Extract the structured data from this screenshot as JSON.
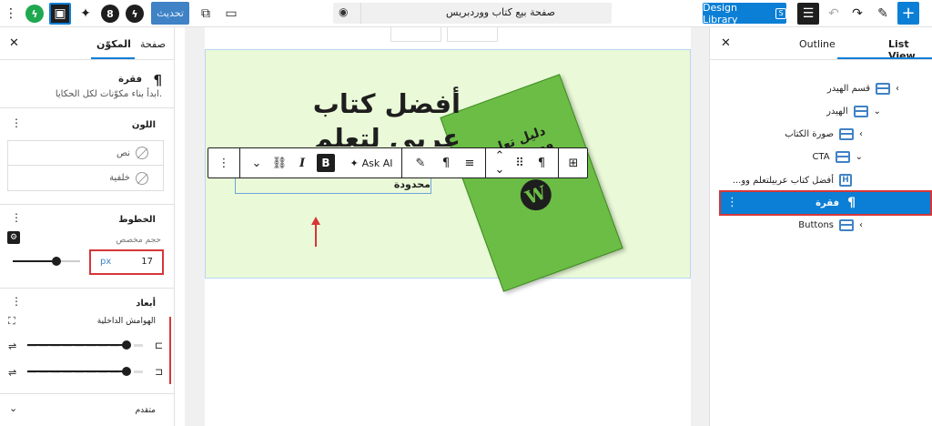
{
  "topbar": {
    "update_label": "تحديث",
    "document_title": "صفحة بيع كتاب ووردبريس",
    "design_library_label": "Design Library",
    "design_library_badge": "S",
    "icons": {
      "kebab": "⋮",
      "sidebar_toggle": "▣",
      "sparkle": "✦",
      "kadence": "8",
      "lightning": "ϟ",
      "green_bolt": "ϟ",
      "external": "⧉",
      "device": "▭",
      "eye": "◉",
      "list_view": "☰",
      "undo": "↶",
      "redo": "↷",
      "pen": "✎",
      "plus": "+"
    }
  },
  "left_panel": {
    "tab_block": "المكوّن",
    "tab_page": "صفحة",
    "close": "✕",
    "block_icon": "¶",
    "block_name": "فقرة",
    "block_description": "ابدأ بناء مكوّنات لكل الحكايا.",
    "color_section": {
      "title": "اللون",
      "dots": "⋮",
      "text_label": "نص",
      "background_label": "خلفية"
    },
    "typography_section": {
      "title": "الخطوط",
      "dots": "⋮",
      "size_label": "حجم مخصص",
      "size_value": "17",
      "size_unit": "px",
      "slider_fraction": 0.65,
      "settings_icon": "⚙"
    },
    "dimensions_section": {
      "title": "أبعاد",
      "dots": "⋮",
      "padding_label": "الهوامش الداخلية",
      "slider_1_fraction": 0.85,
      "slider_2_fraction": 0.85,
      "link_icon": "⛶",
      "adjust_icon": "⇌",
      "side_icon_1": "⊏",
      "side_icon_2": "⊐"
    },
    "advanced_section": {
      "title": "متقدم",
      "chevron": "⌄"
    }
  },
  "canvas": {
    "heading": "أفضل كتاب عربي لتعلم",
    "offer_text": "استفد الآن من خصم 50% لفترة محدودة",
    "book_text": "دليل تعلم ووردبريس",
    "book_logo": "W",
    "toolbar": {
      "block_type_icon": "⊞",
      "paragraph_icon": "¶",
      "drag_icon": "⠿",
      "move_up": "⌃",
      "move_down": "⌄",
      "align_icon": "≡",
      "pilcrow_icon": "¶",
      "highlight_icon": "✎",
      "ask_ai_label": "Ask AI",
      "ask_ai_icon": "✦",
      "bold_label": "B",
      "italic_label": "I",
      "link_icon": "⛓",
      "more_icon": "⌄",
      "options_icon": "⋮"
    }
  },
  "right_panel": {
    "tab_list_view": "List View",
    "tab_outline": "Outline",
    "close": "✕",
    "items": [
      {
        "label": "قسم الهيدر",
        "chevron": "›",
        "kind": "group"
      },
      {
        "label": "الهيدر",
        "chevron": "⌄",
        "kind": "group"
      },
      {
        "label": "صورة الكتاب",
        "chevron": "›",
        "kind": "group"
      },
      {
        "label": "CTA",
        "chevron": "⌄",
        "kind": "group"
      },
      {
        "label": "أفضل كتاب عربيلتعلم وو...",
        "chevron": "",
        "kind": "heading",
        "icon": "H"
      },
      {
        "label": "فقرة",
        "chevron": "",
        "kind": "paragraph",
        "icon": "¶",
        "selected": true
      },
      {
        "label": "Buttons",
        "chevron": "›",
        "kind": "group"
      }
    ],
    "options_icon": "⋮"
  },
  "colors": {
    "accent": "#0b7fd6",
    "highlight_red": "#d63638",
    "cta_background": "#eafad8",
    "book_green": "#6bbd45"
  }
}
